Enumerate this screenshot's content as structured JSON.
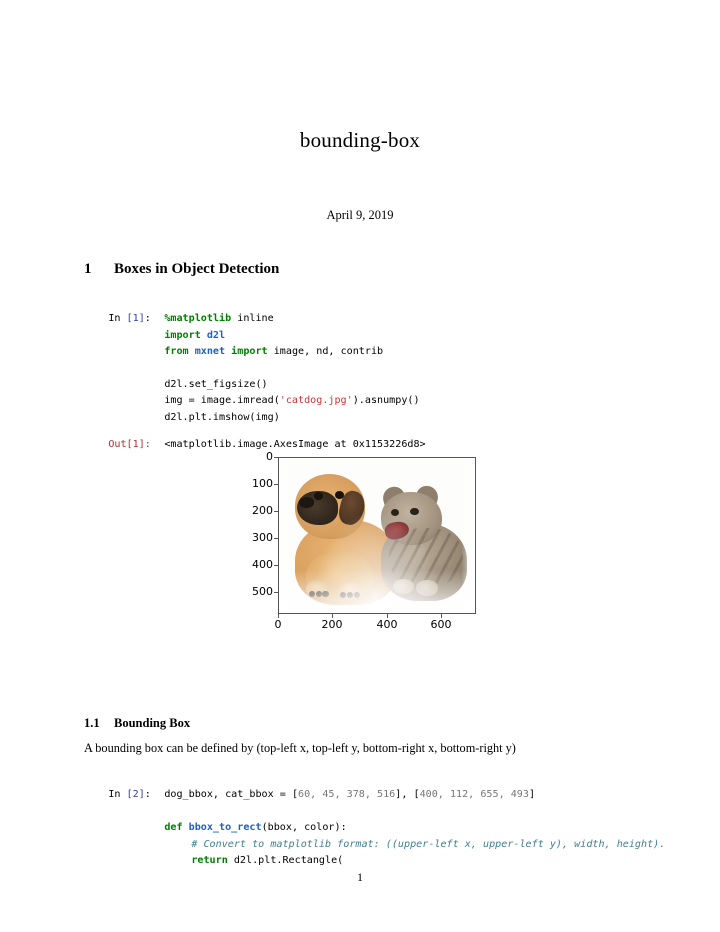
{
  "document": {
    "title": "bounding-box",
    "date": "April 9, 2019",
    "page_number": "1"
  },
  "sections": {
    "s1": {
      "number": "1",
      "heading": "Boxes in Object Detection"
    },
    "s11": {
      "number": "1.1",
      "heading": "Bounding Box"
    },
    "s11_paragraph": "A bounding box can be defined by (top-left x, top-left y, bottom-right x, bottom-right y)"
  },
  "cells": {
    "cell1": {
      "prompt_label": "In",
      "prompt_number": "[1]",
      "prompt_colon": ":",
      "lines": {
        "l1_magic": "%matplotlib",
        "l1_rest": " inline",
        "l2_kw": "import",
        "l2_mod": " d2l",
        "l3_from": "from",
        "l3_mod": " mxnet ",
        "l3_import": "import",
        "l3_names": " image, nd, contrib",
        "l5": "d2l.set_figsize()",
        "l6_a": "img = image.imread(",
        "l6_str": "'catdog.jpg'",
        "l6_b": ").asnumpy()",
        "l7": "d2l.plt.imshow(img)"
      }
    },
    "cell1_out": {
      "prompt_label": "Out",
      "prompt_number": "[1]",
      "prompt_colon": ":",
      "text": "<matplotlib.image.AxesImage at 0x1153226d8>"
    },
    "cell2": {
      "prompt_label": "In",
      "prompt_number": "[2]",
      "prompt_colon": ":",
      "line1_names": "dog_bbox, cat_bbox = ",
      "line1_open1": "[",
      "line1_dog": "60, 45, 378, 516",
      "line1_close1": "], ",
      "line1_open2": "[",
      "line1_cat": "400, 112, 655, 493",
      "line1_close2": "]",
      "line3_def": "def",
      "line3_fn": " bbox_to_rect",
      "line3_args": "(bbox, color):",
      "line4_comment": "# Convert to matplotlib format: ((upper-left x, upper-left y), width, height).",
      "line5_return": "return",
      "line5_rest": " d2l.plt.Rectangle("
    }
  },
  "figure": {
    "chart_data": {
      "type": "image",
      "title": "",
      "xlabel": "",
      "ylabel": "",
      "xlim": [
        0,
        728
      ],
      "ylim": [
        575,
        0
      ],
      "xticks": [
        "0",
        "200",
        "400",
        "600"
      ],
      "yticks": [
        "0",
        "100",
        "200",
        "300",
        "400",
        "500"
      ],
      "grid": false,
      "legend": "none",
      "content_description": "Photograph of a tan puppy on the left and a gray tabby kitten on the right against a white background",
      "bounding_boxes": [
        {
          "name": "dog_bbox",
          "values": [
            60,
            45,
            378,
            516
          ]
        },
        {
          "name": "cat_bbox",
          "values": [
            400,
            112,
            655,
            493
          ]
        }
      ]
    }
  },
  "colors": {
    "keyword": "#008000",
    "name": "#2060c0",
    "string": "#cc3333",
    "comment": "#408090",
    "number": "#767676",
    "prompt_in": "#303f9f",
    "prompt_out": "#b03030"
  }
}
